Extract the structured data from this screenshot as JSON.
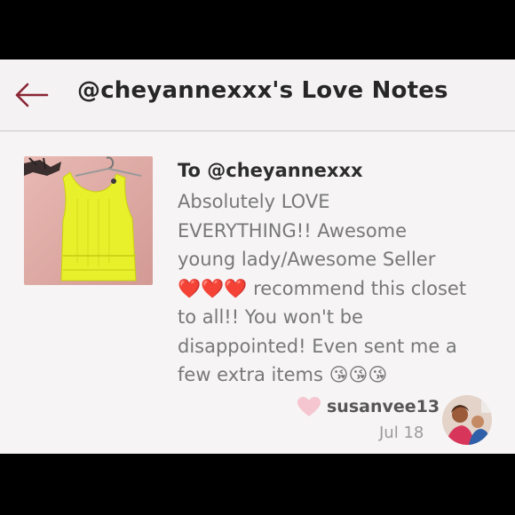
{
  "header": {
    "title": "@cheyannexxx's Love Notes",
    "back_icon": "back-arrow-icon",
    "accent_color": "#8a2534"
  },
  "note": {
    "to_line": "To @cheyannexxx",
    "body": "Absolutely LOVE EVERYTHING!! Awesome young lady/Awesome Seller ❤️❤️❤️ recommend this closet to all!! You won't be disappointed! Even sent me a few extra items 😘😘😘",
    "body_lines": [
      "Absolutely LOVE",
      "EVERYTHING!! Awesome",
      "young lady/Awesome Seller",
      "❤️❤️❤️ recommend this closet",
      "to all!! You won't be",
      "disappointed! Even sent me a",
      "few extra items 😘😘😘"
    ],
    "item_photo": "yellow tank top",
    "author": "susanvee13",
    "date": "Jul 18",
    "heart_color": "#f5c6cf"
  }
}
